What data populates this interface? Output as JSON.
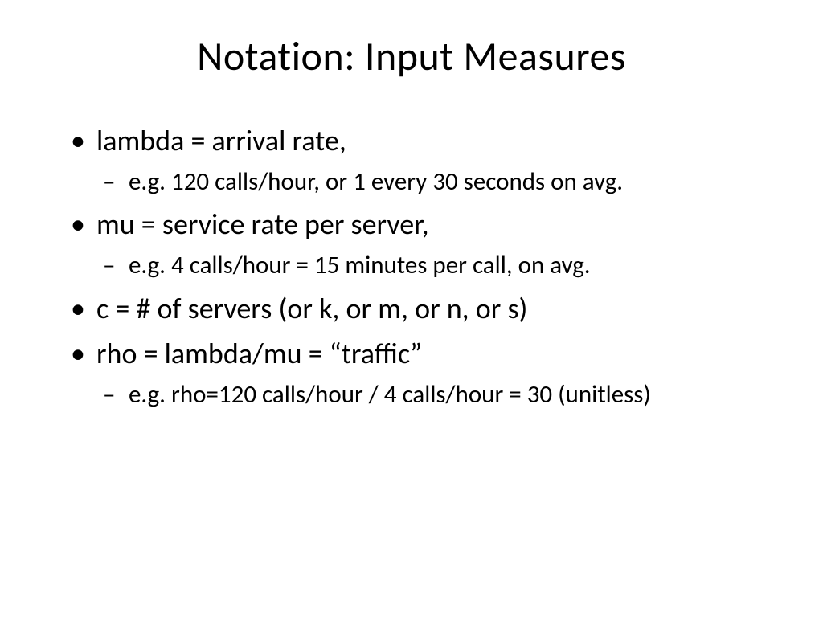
{
  "title": "Notation: Input Measures",
  "bullets": [
    {
      "text": "lambda = arrival rate,",
      "sub": [
        "e.g. 120 calls/hour, or 1 every 30 seconds on avg."
      ]
    },
    {
      "text": "mu = service rate per server,",
      "sub": [
        "e.g. 4 calls/hour = 15 minutes per call, on avg."
      ]
    },
    {
      "text": "c = # of servers (or k, or m, or n, or s)",
      "sub": []
    },
    {
      "text": "rho = lambda/mu = “traffic”",
      "sub": [
        "e.g. rho=120 calls/hour / 4 calls/hour = 30 (unitless)"
      ]
    }
  ]
}
